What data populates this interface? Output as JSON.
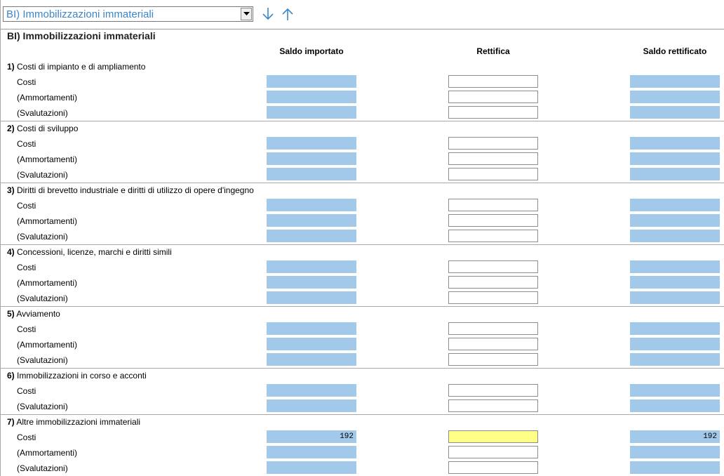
{
  "selector": {
    "value": "BI) Immobilizzazioni immateriali"
  },
  "section_title": "BI) Immobilizzazioni immateriali",
  "columns": [
    "Saldo importato",
    "Rettifica",
    "Saldo rettificato"
  ],
  "groups": [
    {
      "num": "1)",
      "title": "Costi di impianto e di ampliamento",
      "rows": [
        {
          "label": "Costi",
          "v1": "",
          "v2": "",
          "v3": ""
        },
        {
          "label": "(Ammortamenti)",
          "v1": "",
          "v2": "",
          "v3": ""
        },
        {
          "label": "(Svalutazioni)",
          "v1": "",
          "v2": "",
          "v3": ""
        }
      ]
    },
    {
      "num": "2)",
      "title": "Costi di sviluppo",
      "rows": [
        {
          "label": "Costi",
          "v1": "",
          "v2": "",
          "v3": ""
        },
        {
          "label": "(Ammortamenti)",
          "v1": "",
          "v2": "",
          "v3": ""
        },
        {
          "label": "(Svalutazioni)",
          "v1": "",
          "v2": "",
          "v3": ""
        }
      ]
    },
    {
      "num": "3)",
      "title": "Diritti di brevetto industriale e diritti di utilizzo di opere d'ingegno",
      "rows": [
        {
          "label": "Costi",
          "v1": "",
          "v2": "",
          "v3": ""
        },
        {
          "label": "(Ammortamenti)",
          "v1": "",
          "v2": "",
          "v3": ""
        },
        {
          "label": "(Svalutazioni)",
          "v1": "",
          "v2": "",
          "v3": ""
        }
      ]
    },
    {
      "num": "4)",
      "title": "Concessioni, licenze, marchi e diritti simili",
      "rows": [
        {
          "label": "Costi",
          "v1": "",
          "v2": "",
          "v3": ""
        },
        {
          "label": "(Ammortamenti)",
          "v1": "",
          "v2": "",
          "v3": ""
        },
        {
          "label": "(Svalutazioni)",
          "v1": "",
          "v2": "",
          "v3": ""
        }
      ]
    },
    {
      "num": "5)",
      "title": "Avviamento",
      "rows": [
        {
          "label": "Costi",
          "v1": "",
          "v2": "",
          "v3": ""
        },
        {
          "label": "(Ammortamenti)",
          "v1": "",
          "v2": "",
          "v3": ""
        },
        {
          "label": "(Svalutazioni)",
          "v1": "",
          "v2": "",
          "v3": ""
        }
      ]
    },
    {
      "num": "6)",
      "title": "Immobilizzazioni in corso e acconti",
      "rows": [
        {
          "label": "Costi",
          "v1": "",
          "v2": "",
          "v3": ""
        },
        {
          "label": "(Svalutazioni)",
          "v1": "",
          "v2": "",
          "v3": ""
        }
      ]
    },
    {
      "num": "7)",
      "title": "Altre immobilizzazioni immateriali",
      "rows": [
        {
          "label": "Costi",
          "v1": "192",
          "v2": "",
          "v3": "192",
          "focused": true
        },
        {
          "label": "(Ammortamenti)",
          "v1": "",
          "v2": "",
          "v3": ""
        },
        {
          "label": "(Svalutazioni)",
          "v1": "",
          "v2": "",
          "v3": ""
        }
      ]
    }
  ],
  "colors": {
    "readonly_fill": "#a2c8ea",
    "focused_fill": "#ffff88",
    "accent_text": "#3a86c8"
  },
  "icons": {
    "down": "arrow-down-icon",
    "up": "arrow-up-icon",
    "dropdown": "chevron-down-icon"
  }
}
